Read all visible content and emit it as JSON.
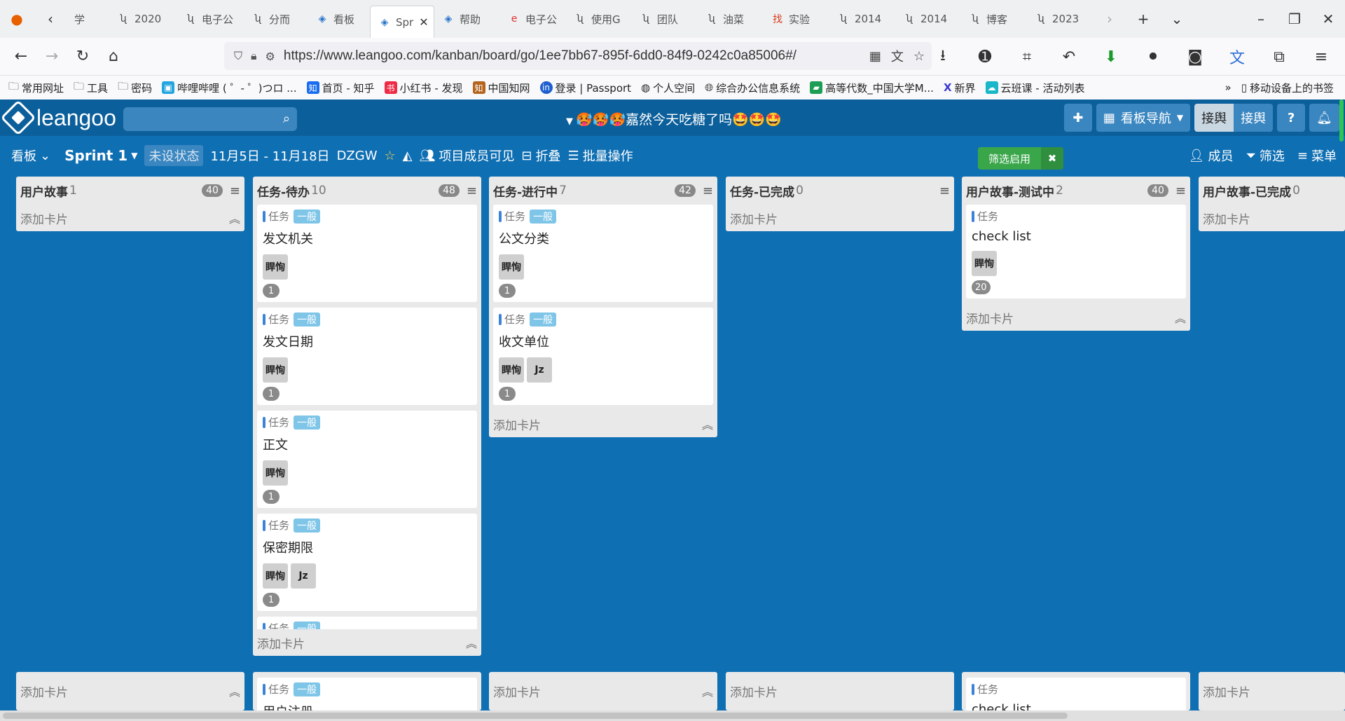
{
  "browser": {
    "tabs": [
      "学",
      "2020",
      "电子公",
      "分而",
      "看板",
      "Spr",
      "帮助",
      "电子公",
      "使用G",
      "团队",
      "油菜",
      "实验",
      "2014",
      "2014",
      "博客",
      "2023"
    ],
    "active_tab": 5,
    "url": "https://www.leangoo.com/kanban/board/go/1ee7bb67-895f-6dd0-84f9-0242c0a85006#/",
    "bookmarks": [
      "常用网址",
      "工具",
      "密码",
      "哔哩哔哩 ( ゜- ゜)つロ ...",
      "首页 - 知乎",
      "小红书 - 发现",
      "中国知网",
      "登录 | Passport",
      "个人空间",
      "综合办公信息系统",
      "高等代数_中国大学M...",
      "新界",
      "云班课 - 活动列表"
    ],
    "mobile_bookmarks": "移动设备上的书签"
  },
  "app": {
    "logo_text": "leangoo",
    "board_title": "🥵🥵🥵嘉然今天吃糖了吗🤩🤩🤩",
    "nav_label": "看板导航",
    "user_a": "接舆",
    "user_b": "接舆",
    "help": "?"
  },
  "toolbar": {
    "view": "看板",
    "sprint": "Sprint 1",
    "status": "未设状态",
    "dates": "11月5日 - 11月18日",
    "project": "DZGW",
    "visibility": "项目成员可见",
    "fold": "折叠",
    "batch": "批量操作",
    "filter_on": "筛选启用",
    "members": "成员",
    "filter": "筛选",
    "menu": "菜单"
  },
  "columns": [
    {
      "name": "用户故事",
      "count": "1",
      "badge": "40",
      "add": "添加卡片"
    },
    {
      "name": "任务-待办",
      "count": "10",
      "badge": "48",
      "add": "添加卡片"
    },
    {
      "name": "任务-进行中",
      "count": "7",
      "badge": "42",
      "add": "添加卡片"
    },
    {
      "name": "任务-已完成",
      "count": "0",
      "badge": "",
      "add": "添加卡片"
    },
    {
      "name": "用户故事-测试中",
      "count": "2",
      "badge": "40",
      "add": "添加卡片"
    },
    {
      "name": "用户故事-已完成",
      "count": "0",
      "badge": "",
      "add": "添加卡片"
    }
  ],
  "card_type": "任务",
  "card_tag": "一般",
  "cards": {
    "todo": [
      {
        "title": "发文机关",
        "people": [
          "睅恂"
        ],
        "num": "1"
      },
      {
        "title": "发文日期",
        "people": [
          "睅恂"
        ],
        "num": "1"
      },
      {
        "title": "正文",
        "people": [
          "睅恂"
        ],
        "num": "1"
      },
      {
        "title": "保密期限",
        "people": [
          "睅恂",
          "Jz"
        ],
        "num": "1"
      }
    ],
    "doing": [
      {
        "title": "公文分类",
        "people": [
          "睅恂"
        ],
        "num": "1"
      },
      {
        "title": "收文单位",
        "people": [
          "睅恂",
          "Jz"
        ],
        "num": "1"
      }
    ],
    "testing": [
      {
        "title": "check list",
        "people": [
          "睅恂"
        ],
        "num": "20"
      }
    ]
  },
  "lower_cards": {
    "todo_title": "用户注册",
    "testing_title": "check list"
  }
}
